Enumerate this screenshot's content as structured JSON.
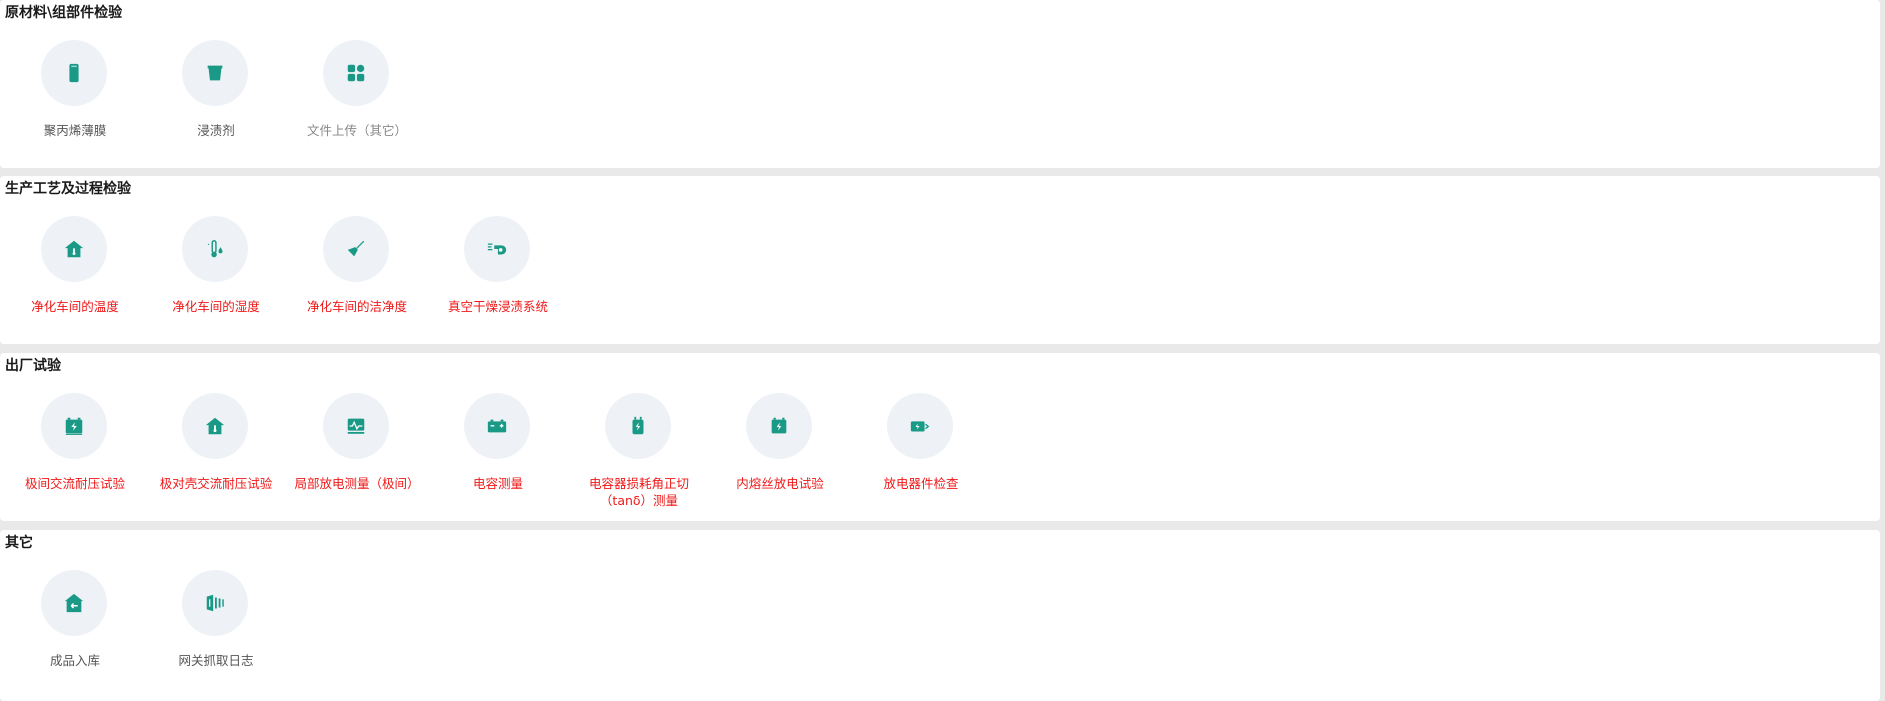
{
  "colors": {
    "icon": "#1a9a86",
    "alert": "#f01818",
    "circle_bg": "#eef2f7"
  },
  "sections": [
    {
      "title": "原材料\\组部件检验",
      "items": [
        {
          "label": "聚丙烯薄膜",
          "icon": "film-icon",
          "status": "normal"
        },
        {
          "label": "浸渍剂",
          "icon": "bucket-icon",
          "status": "normal"
        },
        {
          "label": "文件上传（其它）",
          "icon": "grid-icon",
          "status": "muted"
        }
      ]
    },
    {
      "title": "生产工艺及过程检验",
      "items": [
        {
          "label": "净化车间的温度",
          "icon": "house-thermometer-icon",
          "status": "alert"
        },
        {
          "label": "净化车间的湿度",
          "icon": "thermometer-drop-icon",
          "status": "alert"
        },
        {
          "label": "净化车间的洁净度",
          "icon": "brush-icon",
          "status": "alert"
        },
        {
          "label": "真空干燥浸渍系统",
          "icon": "blower-icon",
          "status": "alert"
        }
      ]
    },
    {
      "title": "出厂试验",
      "items": [
        {
          "label": "极间交流耐压试验",
          "icon": "battery-bolt-icon",
          "status": "alert"
        },
        {
          "label": "极对壳交流耐压试验",
          "icon": "house-thermometer-icon",
          "status": "alert"
        },
        {
          "label": "局部放电测量（极间）",
          "icon": "monitor-wave-icon",
          "status": "alert"
        },
        {
          "label": "电容测量",
          "icon": "battery-terminal-icon",
          "status": "alert"
        },
        {
          "label": "电容器损耗角正切（tanδ）测量",
          "icon": "capacitor-bolt-icon",
          "status": "alert"
        },
        {
          "label": "内熔丝放电试验",
          "icon": "battery-bolt-small-icon",
          "status": "alert"
        },
        {
          "label": "放电器件检查",
          "icon": "battery-charge-icon",
          "status": "alert"
        }
      ]
    },
    {
      "title": "其它",
      "items": [
        {
          "label": "成品入库",
          "icon": "warehouse-in-icon",
          "status": "normal"
        },
        {
          "label": "网关抓取日志",
          "icon": "gateway-log-icon",
          "status": "normal"
        }
      ]
    }
  ]
}
